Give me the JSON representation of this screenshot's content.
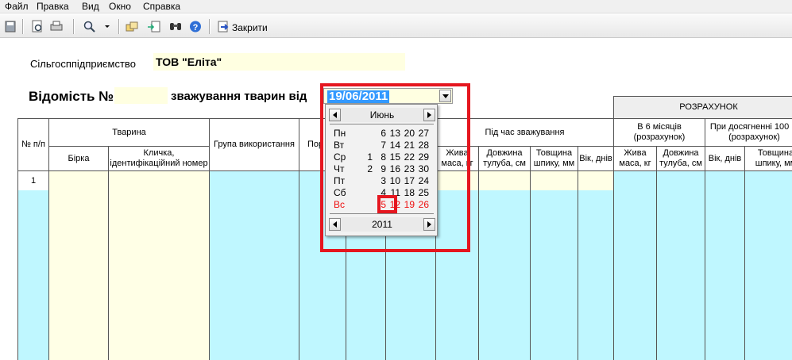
{
  "menu": [
    "Файл",
    "Правка",
    "Вид",
    "Окно",
    "Справка"
  ],
  "toolbar": {
    "close_label": "Закрити"
  },
  "form": {
    "enterprise_label": "Сільгосппідприємство",
    "enterprise_value": "ТОВ \"Еліта\"",
    "title_prefix": "Відомість №",
    "title_middle": "зважування тварин  від",
    "date_value": "19/06/2011"
  },
  "table": {
    "header_calc": "РОЗРАХУНОК",
    "col_num": "№ п/п",
    "group_animal": "Тварина",
    "col_tag": "Бірка",
    "col_name": "Кличка, ідентифікаційний номер",
    "col_group": "Група використання",
    "col_breed_partial": "Пор",
    "group_weighing": "Під час зважування",
    "col_live_weight_partial": "Жива маса, кг",
    "col_body_length": "Довжина тулуба, см",
    "col_fat_thickness": "Товщина шпику, мм",
    "col_age_days": "Вік, днів",
    "group_6months": "В 6 місяців (розрахунок)",
    "col_6m_live_weight": "Жива маса, кг",
    "col_6m_body_length": "Довжина тулуба, см",
    "group_100kg": "При досягненні 100 кг (розрахунок)",
    "col_100_age": "Вік, днів",
    "col_100_fat": "Товщина шпику, мм",
    "row_number": "1"
  },
  "calendar": {
    "month": "Июнь",
    "year": "2011",
    "rows": [
      {
        "day": "Пн",
        "dates": [
          "6",
          "13",
          "20",
          "27"
        ]
      },
      {
        "day": "Вт",
        "dates": [
          "7",
          "14",
          "21",
          "28"
        ]
      },
      {
        "day": "Ср",
        "dates": [
          "1",
          "8",
          "15",
          "22",
          "29"
        ]
      },
      {
        "day": "Чт",
        "dates": [
          "2",
          "9",
          "16",
          "23",
          "30"
        ]
      },
      {
        "day": "Пт",
        "dates": [
          "3",
          "10",
          "17",
          "24"
        ]
      },
      {
        "day": "Сб",
        "dates": [
          "4",
          "11",
          "18",
          "25"
        ]
      },
      {
        "day": "Вс",
        "dates": [
          "5",
          "12",
          "19",
          "26"
        ]
      }
    ],
    "selected": "19"
  },
  "colors": {
    "highlight": "#e5161f",
    "yellow_field": "#ffffe1",
    "cyan_cell": "#bff7ff"
  }
}
